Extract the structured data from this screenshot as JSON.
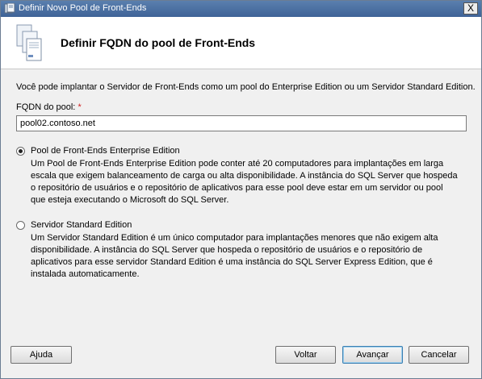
{
  "window": {
    "title": "Definir Novo Pool de Front-Ends",
    "close_label": "X"
  },
  "header": {
    "title": "Definir FQDN do pool de Front-Ends",
    "icon": "server-stack-icon"
  },
  "intro_text": "Você pode implantar o Servidor de Front-Ends como um pool do Enterprise Edition ou um Servidor Standard Edition.",
  "fqdn": {
    "label": "FQDN do pool:",
    "required_mark": "*",
    "value": "pool02.contoso.net"
  },
  "options": [
    {
      "title": "Pool de Front-Ends Enterprise Edition",
      "selected": true,
      "lines": [
        "Um Pool de Front-Ends Enterprise Edition pode conter até 20 computadores para implantações em larga",
        "escala que exigem balanceamento de carga ou alta disponibilidade. A instância do SQL Server que hospeda",
        "o repositório de usuários e o repositório de aplicativos para esse pool deve estar em um servidor ou pool",
        "que esteja executando o Microsoft do SQL Server."
      ]
    },
    {
      "title": "Servidor Standard Edition",
      "selected": false,
      "lines": [
        "Um Servidor Standard Edition é um único computador para implantações menores que não exigem alta",
        "disponibilidade.  A instância do SQL Server que hospeda o repositório de usuários e o repositório de",
        "aplicativos para esse servidor Standard Edition é uma instância do SQL Server Express Edition, que é",
        "instalada automaticamente."
      ]
    }
  ],
  "buttons": {
    "help": "Ajuda",
    "back": "Voltar",
    "next": "Avançar",
    "cancel": "Cancelar"
  }
}
